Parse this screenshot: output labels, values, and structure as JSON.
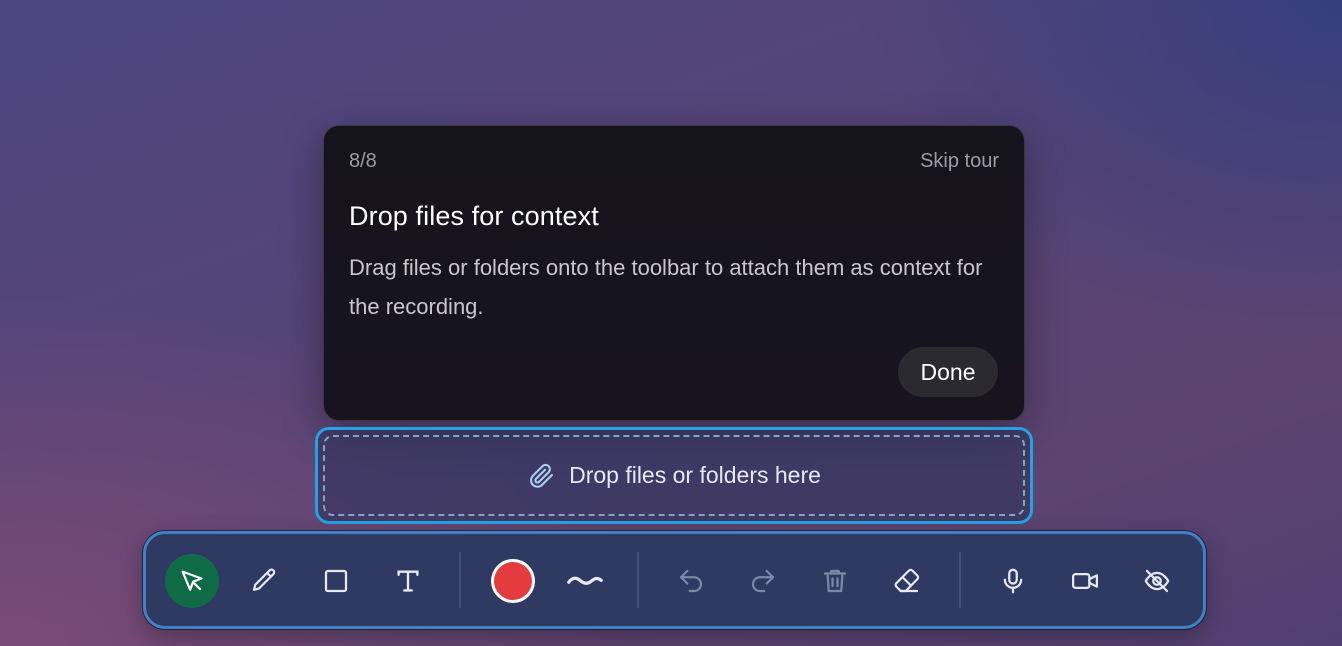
{
  "tour": {
    "step": "8/8",
    "skip_label": "Skip tour",
    "title": "Drop files for context",
    "body": "Drag files or folders onto the toolbar to attach them as context for the recording.",
    "done_label": "Done"
  },
  "drop_zone": {
    "label": "Drop files or folders here",
    "icon": "paperclip-icon",
    "accent": "#23a3e6"
  },
  "toolbar": {
    "tools": [
      "select-arrow-icon",
      "pencil-icon",
      "rectangle-icon",
      "text-icon",
      "color-swatch",
      "stroke-wave-icon",
      "undo-icon",
      "redo-icon",
      "trash-icon",
      "eraser-icon",
      "microphone-icon",
      "video-camera-icon",
      "eye-off-icon"
    ],
    "active_tool": "select-arrow-icon",
    "active_color": "#0e6b45",
    "selected_color": "#e33b3e"
  }
}
